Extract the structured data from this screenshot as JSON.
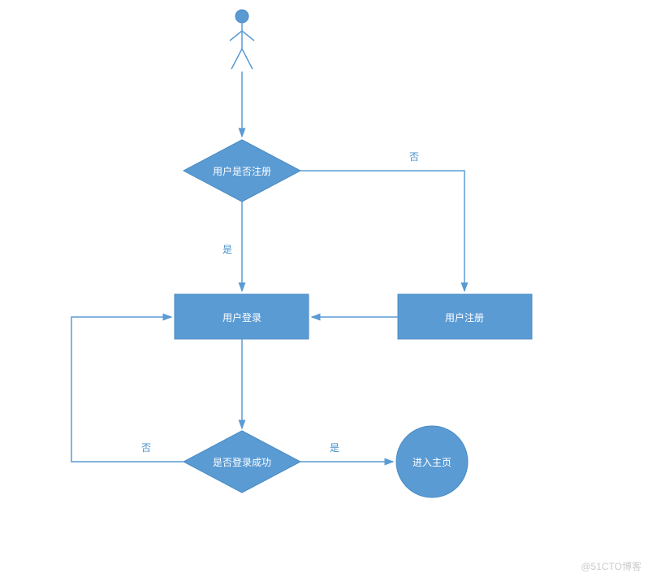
{
  "diagram": {
    "decision1": "用户是否注册",
    "decision2": "是否登录成功",
    "process_login": "用户登录",
    "process_register": "用户注册",
    "enter_main": "进入主页",
    "label_yes": "是",
    "label_no": "否",
    "colors": {
      "shape_fill": "#5a9bd4",
      "shape_stroke": "#4a8bc4",
      "line": "#5a9bd4",
      "actor": "#5a9bd4"
    }
  },
  "watermark": "@51CTO博客"
}
